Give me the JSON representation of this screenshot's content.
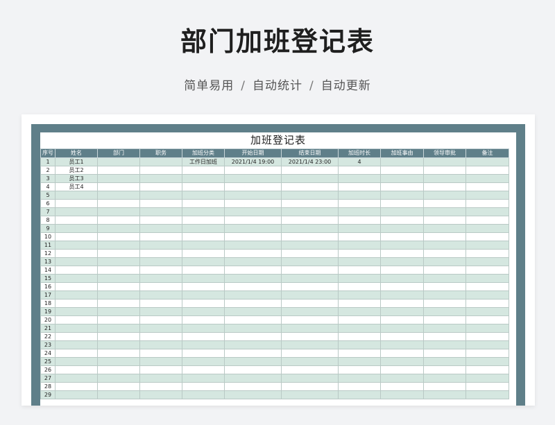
{
  "header": {
    "title": "部门加班登记表",
    "subtitle_parts": [
      "简单易用",
      "自动统计",
      "自动更新"
    ],
    "separator": "/"
  },
  "sheet": {
    "title": "加班登记表",
    "columns": [
      "序号",
      "姓名",
      "部门",
      "职务",
      "加班分类",
      "开始日期",
      "结束日期",
      "加班时长",
      "加班事由",
      "领导审批",
      "备注"
    ],
    "rows": [
      [
        "1",
        "员工1",
        "",
        "",
        "工作日加班",
        "2021/1/4 19:00",
        "2021/1/4 23:00",
        "4",
        "",
        "",
        ""
      ],
      [
        "2",
        "员工2",
        "",
        "",
        "",
        "",
        "",
        "",
        "",
        "",
        ""
      ],
      [
        "3",
        "员工3",
        "",
        "",
        "",
        "",
        "",
        "",
        "",
        "",
        ""
      ],
      [
        "4",
        "员工4",
        "",
        "",
        "",
        "",
        "",
        "",
        "",
        "",
        ""
      ],
      [
        "5",
        "",
        "",
        "",
        "",
        "",
        "",
        "",
        "",
        "",
        ""
      ],
      [
        "6",
        "",
        "",
        "",
        "",
        "",
        "",
        "",
        "",
        "",
        ""
      ],
      [
        "7",
        "",
        "",
        "",
        "",
        "",
        "",
        "",
        "",
        "",
        ""
      ],
      [
        "8",
        "",
        "",
        "",
        "",
        "",
        "",
        "",
        "",
        "",
        ""
      ],
      [
        "9",
        "",
        "",
        "",
        "",
        "",
        "",
        "",
        "",
        "",
        ""
      ],
      [
        "10",
        "",
        "",
        "",
        "",
        "",
        "",
        "",
        "",
        "",
        ""
      ],
      [
        "11",
        "",
        "",
        "",
        "",
        "",
        "",
        "",
        "",
        "",
        ""
      ],
      [
        "12",
        "",
        "",
        "",
        "",
        "",
        "",
        "",
        "",
        "",
        ""
      ],
      [
        "13",
        "",
        "",
        "",
        "",
        "",
        "",
        "",
        "",
        "",
        ""
      ],
      [
        "14",
        "",
        "",
        "",
        "",
        "",
        "",
        "",
        "",
        "",
        ""
      ],
      [
        "15",
        "",
        "",
        "",
        "",
        "",
        "",
        "",
        "",
        "",
        ""
      ],
      [
        "16",
        "",
        "",
        "",
        "",
        "",
        "",
        "",
        "",
        "",
        ""
      ],
      [
        "17",
        "",
        "",
        "",
        "",
        "",
        "",
        "",
        "",
        "",
        ""
      ],
      [
        "18",
        "",
        "",
        "",
        "",
        "",
        "",
        "",
        "",
        "",
        ""
      ],
      [
        "19",
        "",
        "",
        "",
        "",
        "",
        "",
        "",
        "",
        "",
        ""
      ],
      [
        "20",
        "",
        "",
        "",
        "",
        "",
        "",
        "",
        "",
        "",
        ""
      ],
      [
        "21",
        "",
        "",
        "",
        "",
        "",
        "",
        "",
        "",
        "",
        ""
      ],
      [
        "22",
        "",
        "",
        "",
        "",
        "",
        "",
        "",
        "",
        "",
        ""
      ],
      [
        "23",
        "",
        "",
        "",
        "",
        "",
        "",
        "",
        "",
        "",
        ""
      ],
      [
        "24",
        "",
        "",
        "",
        "",
        "",
        "",
        "",
        "",
        "",
        ""
      ],
      [
        "25",
        "",
        "",
        "",
        "",
        "",
        "",
        "",
        "",
        "",
        ""
      ],
      [
        "26",
        "",
        "",
        "",
        "",
        "",
        "",
        "",
        "",
        "",
        ""
      ],
      [
        "27",
        "",
        "",
        "",
        "",
        "",
        "",
        "",
        "",
        "",
        ""
      ],
      [
        "28",
        "",
        "",
        "",
        "",
        "",
        "",
        "",
        "",
        "",
        ""
      ],
      [
        "29",
        "",
        "",
        "",
        "",
        "",
        "",
        "",
        "",
        "",
        ""
      ]
    ]
  },
  "colors": {
    "frame": "#5f7f89",
    "header_bg": "#5f7f89",
    "row_stripe": "#d5e7e0"
  }
}
